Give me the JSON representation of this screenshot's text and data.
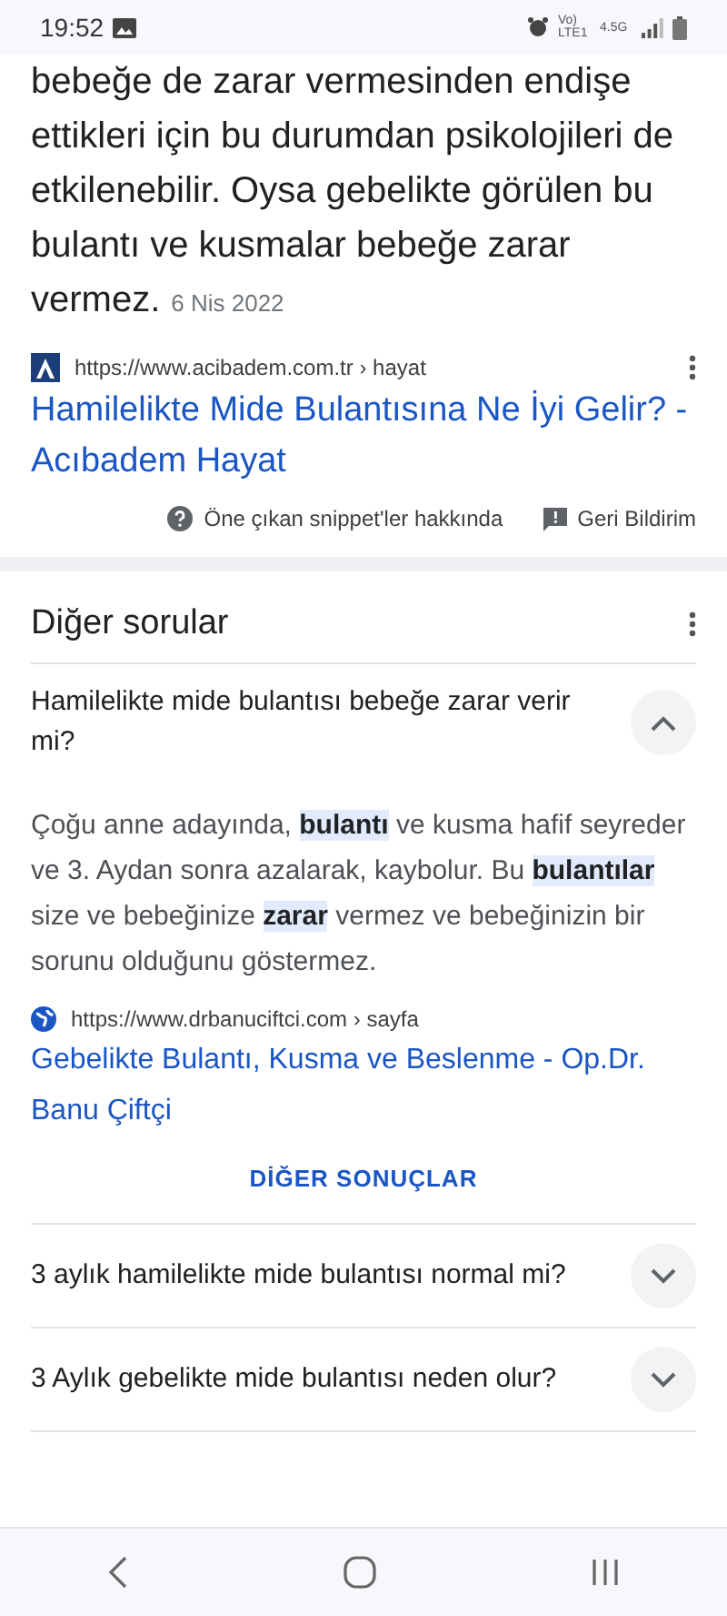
{
  "status_bar": {
    "time": "19:52",
    "network": "Vo) LTE1",
    "data": "4.5G"
  },
  "snippet": {
    "text": "bebeğe de zarar vermesinden endişe ettikleri için bu durumdan psikolojileri de etkilenebilir. Oysa gebelikte görülen bu bulantı ve kusmalar bebeğe zarar vermez.",
    "date": "6 Nis 2022",
    "source": {
      "url": "https://www.acibadem.com.tr › hayat",
      "title": "Hamilelikte Mide Bulantısına Ne İyi Gelir? - Acıbadem Hayat"
    },
    "footer": [
      {
        "kind": "help",
        "label": "Öne çıkan snippet'ler hakkında"
      },
      {
        "kind": "feedback",
        "label": "Geri Bildirim"
      }
    ]
  },
  "other_questions": {
    "title": "Diğer sorular",
    "items": [
      {
        "question": "Hamilelikte mide bulantısı bebeğe zarar verir mi?",
        "expanded": true,
        "answer": "Çoğu anne adayında, **bulantı** ve kusma hafif seyreder ve 3. Aydan sonra azalarak, kaybolur. Bu **bulantılar** size ve bebeğinize **zarar** vermez ve bebeğinizin bir sorunu olduğunu göstermez.",
        "source": {
          "url": "https://www.drbanuciftci.com › sayfa",
          "title": "Gebelikte Bulantı, Kusma ve Beslenme - Op.Dr. Banu Çiftçi"
        },
        "more": "DİĞER SONUÇLAR"
      },
      {
        "question": "3 aylık hamilelikte mide bulantısı normal mi?",
        "expanded": false
      },
      {
        "question": "3 Aylık gebelikte mide bulantısı neden olur?",
        "expanded": false
      }
    ]
  }
}
